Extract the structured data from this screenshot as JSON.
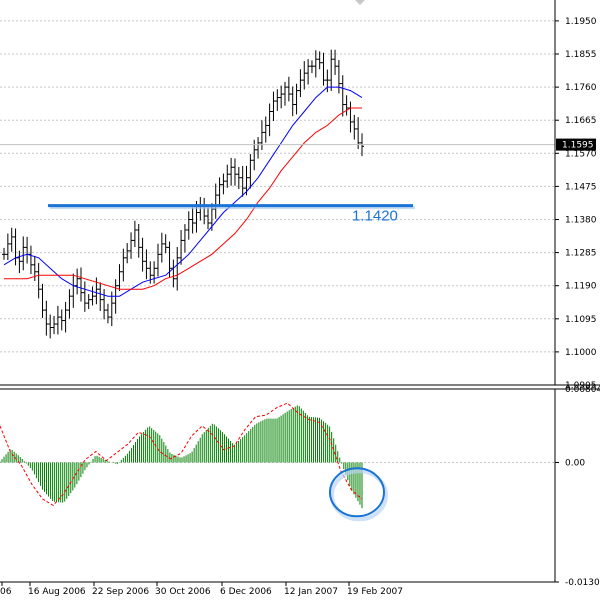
{
  "chart_data": [
    {
      "type": "bar",
      "subtype": "ohlc",
      "panel": "price",
      "y_ticks": [
        "1.1950",
        "1.1855",
        "1.1760",
        "1.1665",
        "1.1570",
        "1.1475",
        "1.1380",
        "1.1285",
        "1.1190",
        "1.1095",
        "1.1000",
        "1.0905"
      ],
      "ylim": [
        1.0905,
        1.201
      ],
      "current_price": "1.1595",
      "horizontal_line": {
        "label": "1.1420",
        "value": 1.142,
        "color": "#1a73d6"
      },
      "series": [
        {
          "name": "",
          "color": "#000000",
          "role": "price bars",
          "values": [
            1.128,
            1.131,
            1.133,
            1.127,
            1.126,
            1.13,
            1.128,
            1.125,
            1.123,
            1.118,
            1.112,
            1.108,
            1.107,
            1.108,
            1.11,
            1.109,
            1.112,
            1.116,
            1.119,
            1.121,
            1.117,
            1.114,
            1.115,
            1.116,
            1.118,
            1.115,
            1.112,
            1.11,
            1.114,
            1.119,
            1.123,
            1.127,
            1.129,
            1.132,
            1.135,
            1.13,
            1.126,
            1.124,
            1.122,
            1.124,
            1.128,
            1.131,
            1.13,
            1.124,
            1.121,
            1.127,
            1.132,
            1.135,
            1.138,
            1.137,
            1.14,
            1.142,
            1.139,
            1.137,
            1.141,
            1.145,
            1.148,
            1.149,
            1.151,
            1.153,
            1.151,
            1.15,
            1.147,
            1.15,
            1.155,
            1.158,
            1.16,
            1.163,
            1.165,
            1.169,
            1.172,
            1.173,
            1.174,
            1.176,
            1.174,
            1.171,
            1.175,
            1.178,
            1.18,
            1.182,
            1.182,
            1.184,
            1.183,
            1.178,
            1.178,
            1.184,
            1.182,
            1.177,
            1.171,
            1.17,
            1.166,
            1.164,
            1.16,
            1.159
          ]
        },
        {
          "name": "",
          "color": "#0000ff",
          "role": "moving average",
          "values": [
            1.125,
            1.127,
            1.128,
            1.127,
            1.124,
            1.121,
            1.119,
            1.118,
            1.117,
            1.116,
            1.116,
            1.118,
            1.12,
            1.121,
            1.122,
            1.125,
            1.128,
            1.132,
            1.136,
            1.14,
            1.143,
            1.146,
            1.15,
            1.155,
            1.16,
            1.165,
            1.169,
            1.173,
            1.176,
            1.176,
            1.175,
            1.173
          ]
        },
        {
          "name": "",
          "color": "#ff0000",
          "role": "moving average",
          "values": [
            1.121,
            1.121,
            1.121,
            1.122,
            1.122,
            1.122,
            1.122,
            1.121,
            1.12,
            1.119,
            1.118,
            1.118,
            1.118,
            1.119,
            1.121,
            1.122,
            1.124,
            1.126,
            1.128,
            1.131,
            1.134,
            1.138,
            1.143,
            1.147,
            1.152,
            1.156,
            1.16,
            1.163,
            1.165,
            1.168,
            1.17,
            1.17
          ]
        }
      ]
    },
    {
      "type": "bar",
      "subtype": "histogram",
      "panel": "oscillator",
      "y_ticks": [
        "0.00804",
        "0.00",
        "-0.01308"
      ],
      "ylim": [
        -0.01308,
        0.00804
      ],
      "series": [
        {
          "name": "",
          "color": "#008000",
          "role": "histogram",
          "values": [
            0.0001,
            0.0015,
            0.0005,
            -0.0008,
            -0.003,
            -0.0043,
            -0.0044,
            -0.0028,
            -0.0008,
            0.0008,
            0.0002,
            -0.0002,
            0.001,
            0.0027,
            0.004,
            0.003,
            0.001,
            0.0005,
            0.0011,
            0.0031,
            0.0043,
            0.0032,
            0.0019,
            0.003,
            0.0042,
            0.0048,
            0.0048,
            0.0056,
            0.0063,
            0.005,
            0.0049,
            0.0039,
            0.0002,
            -0.003,
            -0.005
          ]
        },
        {
          "name": "",
          "color": "#ff0000",
          "role": "signal line",
          "values": [
            0.004,
            0.0011,
            -0.0003,
            -0.0024,
            -0.004,
            -0.0047,
            -0.0034,
            -0.0015,
            0.0003,
            0.0012,
            0.0002,
            0.0011,
            0.002,
            0.0033,
            0.0029,
            0.0012,
            0.0004,
            0.001,
            0.0029,
            0.004,
            0.003,
            0.0014,
            0.0018,
            0.0036,
            0.005,
            0.0052,
            0.006,
            0.0065,
            0.0054,
            0.0047,
            0.0044,
            0.0025,
            -0.0009,
            -0.003,
            -0.004
          ]
        }
      ]
    }
  ],
  "x_labels": [
    "06",
    "16 Aug 2006",
    "22 Sep 2006",
    "30 Oct 2006",
    "6 Dec 2006",
    "12 Jan 2007",
    "19 Feb 2007"
  ],
  "colors": {
    "background": "#ffffff",
    "grid": "#c8c8c8",
    "price_bars": "#000000",
    "ma_fast": "#0000ff",
    "ma_slow": "#ff0000",
    "histogram": "#008000",
    "signal": "#ff0000",
    "highlight_line": "#1a73d6",
    "highlight_circle": "#1a73d6",
    "price_tag": "#000000"
  }
}
